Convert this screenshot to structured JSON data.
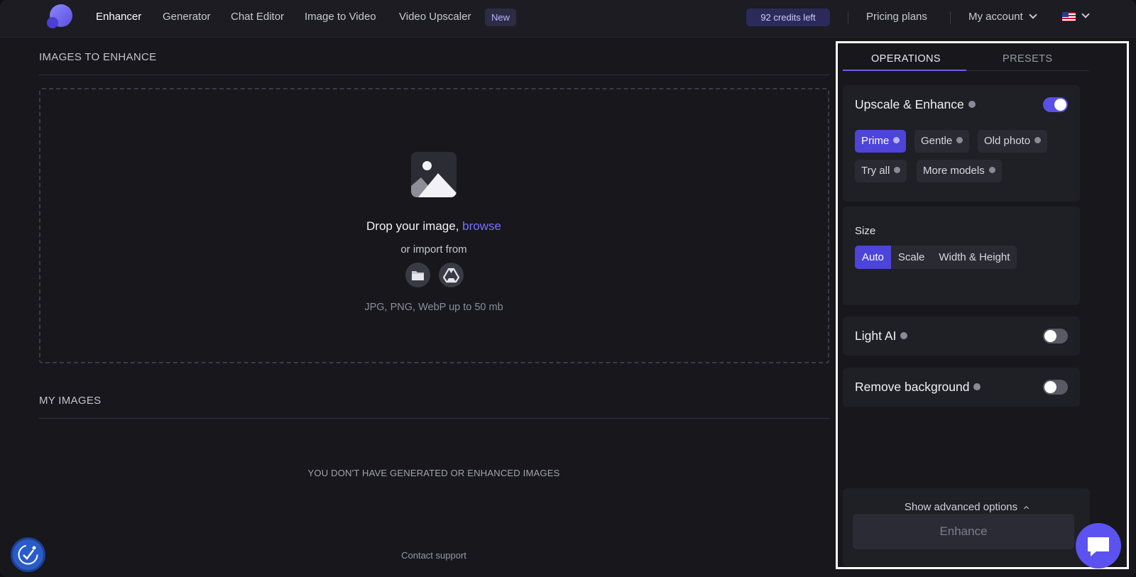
{
  "nav": {
    "items": [
      "Enhancer",
      "Generator",
      "Chat Editor",
      "Image to Video",
      "Video Upscaler"
    ],
    "new_badge": "New",
    "credits": "92 credits left",
    "pricing": "Pricing plans",
    "account": "My account",
    "language_flag": "us-flag-icon"
  },
  "images_to_enhance": {
    "title": "IMAGES TO ENHANCE",
    "drop_text": "Drop your image,",
    "browse": "browse",
    "import_text": "or import from",
    "formats": "JPG, PNG, WebP up to 50 mb",
    "import_sources": [
      "folder-icon",
      "google-drive-icon"
    ]
  },
  "my_images": {
    "title": "MY IMAGES",
    "empty_message": "YOU DON'T HAVE GENERATED OR ENHANCED IMAGES"
  },
  "footer": {
    "contact": "Contact support"
  },
  "panel": {
    "tabs": [
      "OPERATIONS",
      "PRESETS"
    ],
    "active_tab": "OPERATIONS",
    "upscale": {
      "title": "Upscale & Enhance",
      "enabled": true,
      "models": [
        "Prime",
        "Gentle",
        "Old photo",
        "Try all",
        "More models"
      ],
      "selected_model": "Prime"
    },
    "size": {
      "label": "Size",
      "options": [
        "Auto",
        "Scale",
        "Width & Height"
      ],
      "selected": "Auto"
    },
    "light_ai": {
      "title": "Light AI",
      "enabled": false
    },
    "remove_background": {
      "title": "Remove background",
      "enabled": false
    },
    "advanced": "Show advanced options",
    "enhance_button": "Enhance"
  },
  "colors": {
    "accent": "#5a50e6",
    "background": "#17171c",
    "card": "#1f1f26"
  }
}
